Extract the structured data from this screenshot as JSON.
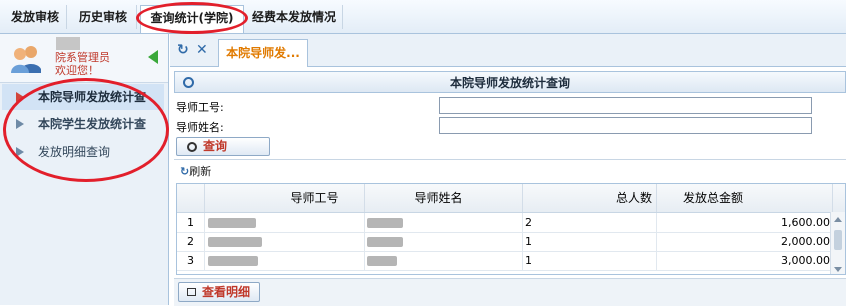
{
  "topbar": {
    "items": [
      "发放审核",
      "历史审核",
      "查询统计(学院)",
      "经费本发放情况"
    ],
    "active_index": 2
  },
  "left_panel": {
    "user_role": "院系管理员",
    "welcome": "欢迎您！",
    "nav_items": [
      "本院导师发放统计查",
      "本院学生发放统计查",
      "发放明细查询"
    ],
    "active_index": 0
  },
  "tabs": {
    "refresh_icon": "refresh-icon",
    "close_icon": "close-icon",
    "active_label": "本院导师发..."
  },
  "query_panel": {
    "title": "本院导师发放统计查询",
    "fields": [
      {
        "label": "导师工号:",
        "value": ""
      },
      {
        "label": "导师姓名:",
        "value": ""
      }
    ],
    "search_button": "查询"
  },
  "grid": {
    "refresh_label": "刷新",
    "columns": [
      "",
      "导师工号",
      "导师姓名",
      "总人数",
      "发放总金额"
    ],
    "rows": [
      {
        "index": "1",
        "people": "2",
        "amount": "1,600.00"
      },
      {
        "index": "2",
        "people": "1",
        "amount": "2,000.00"
      },
      {
        "index": "3",
        "people": "1",
        "amount": "3,000.00"
      }
    ]
  },
  "footer": {
    "view_detail_button": "查看明细"
  },
  "colors": {
    "annotation_red": "#e21f2b",
    "accent_orange": "#e07a00",
    "header_blue": "#2f6aa8"
  }
}
